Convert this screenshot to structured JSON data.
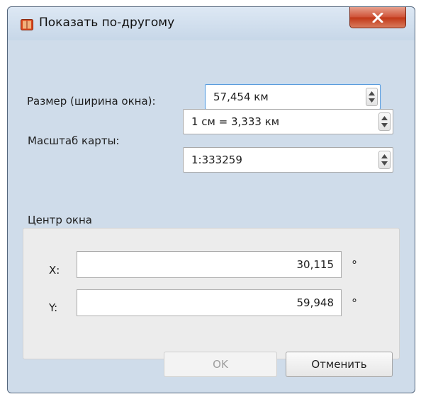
{
  "window": {
    "title": "Показать по-другому",
    "close_symbol": "X",
    "icon": "map-book-icon"
  },
  "size": {
    "label": "Размер (ширина окна):",
    "value": "57,454 км"
  },
  "scale": {
    "label": "Масштаб карты:",
    "ratio_value": "1 см = 3,333 км",
    "fraction_value": "1:333259"
  },
  "center": {
    "group_label": "Центр окна",
    "x_label": "X:",
    "x_value": "30,115",
    "y_label": "Y:",
    "y_value": "59,948",
    "degree_symbol": "°"
  },
  "buttons": {
    "ok_label": "OK",
    "cancel_label": "Отменить"
  },
  "colors": {
    "close_button": "#c94a2c",
    "focus_border": "#5a9bdc",
    "client_background": "#f0f0f0"
  }
}
